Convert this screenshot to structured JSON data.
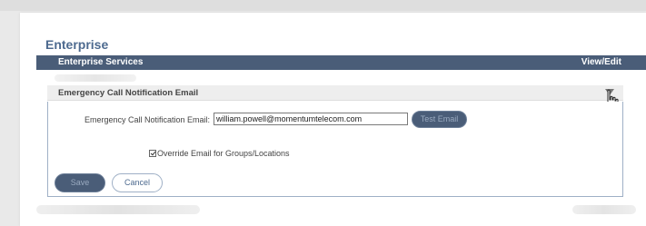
{
  "page": {
    "title": "Enterprise"
  },
  "services_bar": {
    "label": "Enterprise Services",
    "action": "View/Edit"
  },
  "section": {
    "title": "Emergency Call Notification Email",
    "collapse_icon": "collapse-arrow-icon"
  },
  "form": {
    "email_label": "Emergency Call Notification Email:",
    "email_value": "william.powell@momentumtelecom.com",
    "test_email_label": "Test Email",
    "override_label": "Override Email for Groups/Locations",
    "override_checked": true,
    "save_label": "Save",
    "cancel_label": "Cancel"
  },
  "colors": {
    "bar_bg": "#4a5d78",
    "title_color": "#4d6a8f",
    "border": "#9fb0c6"
  }
}
